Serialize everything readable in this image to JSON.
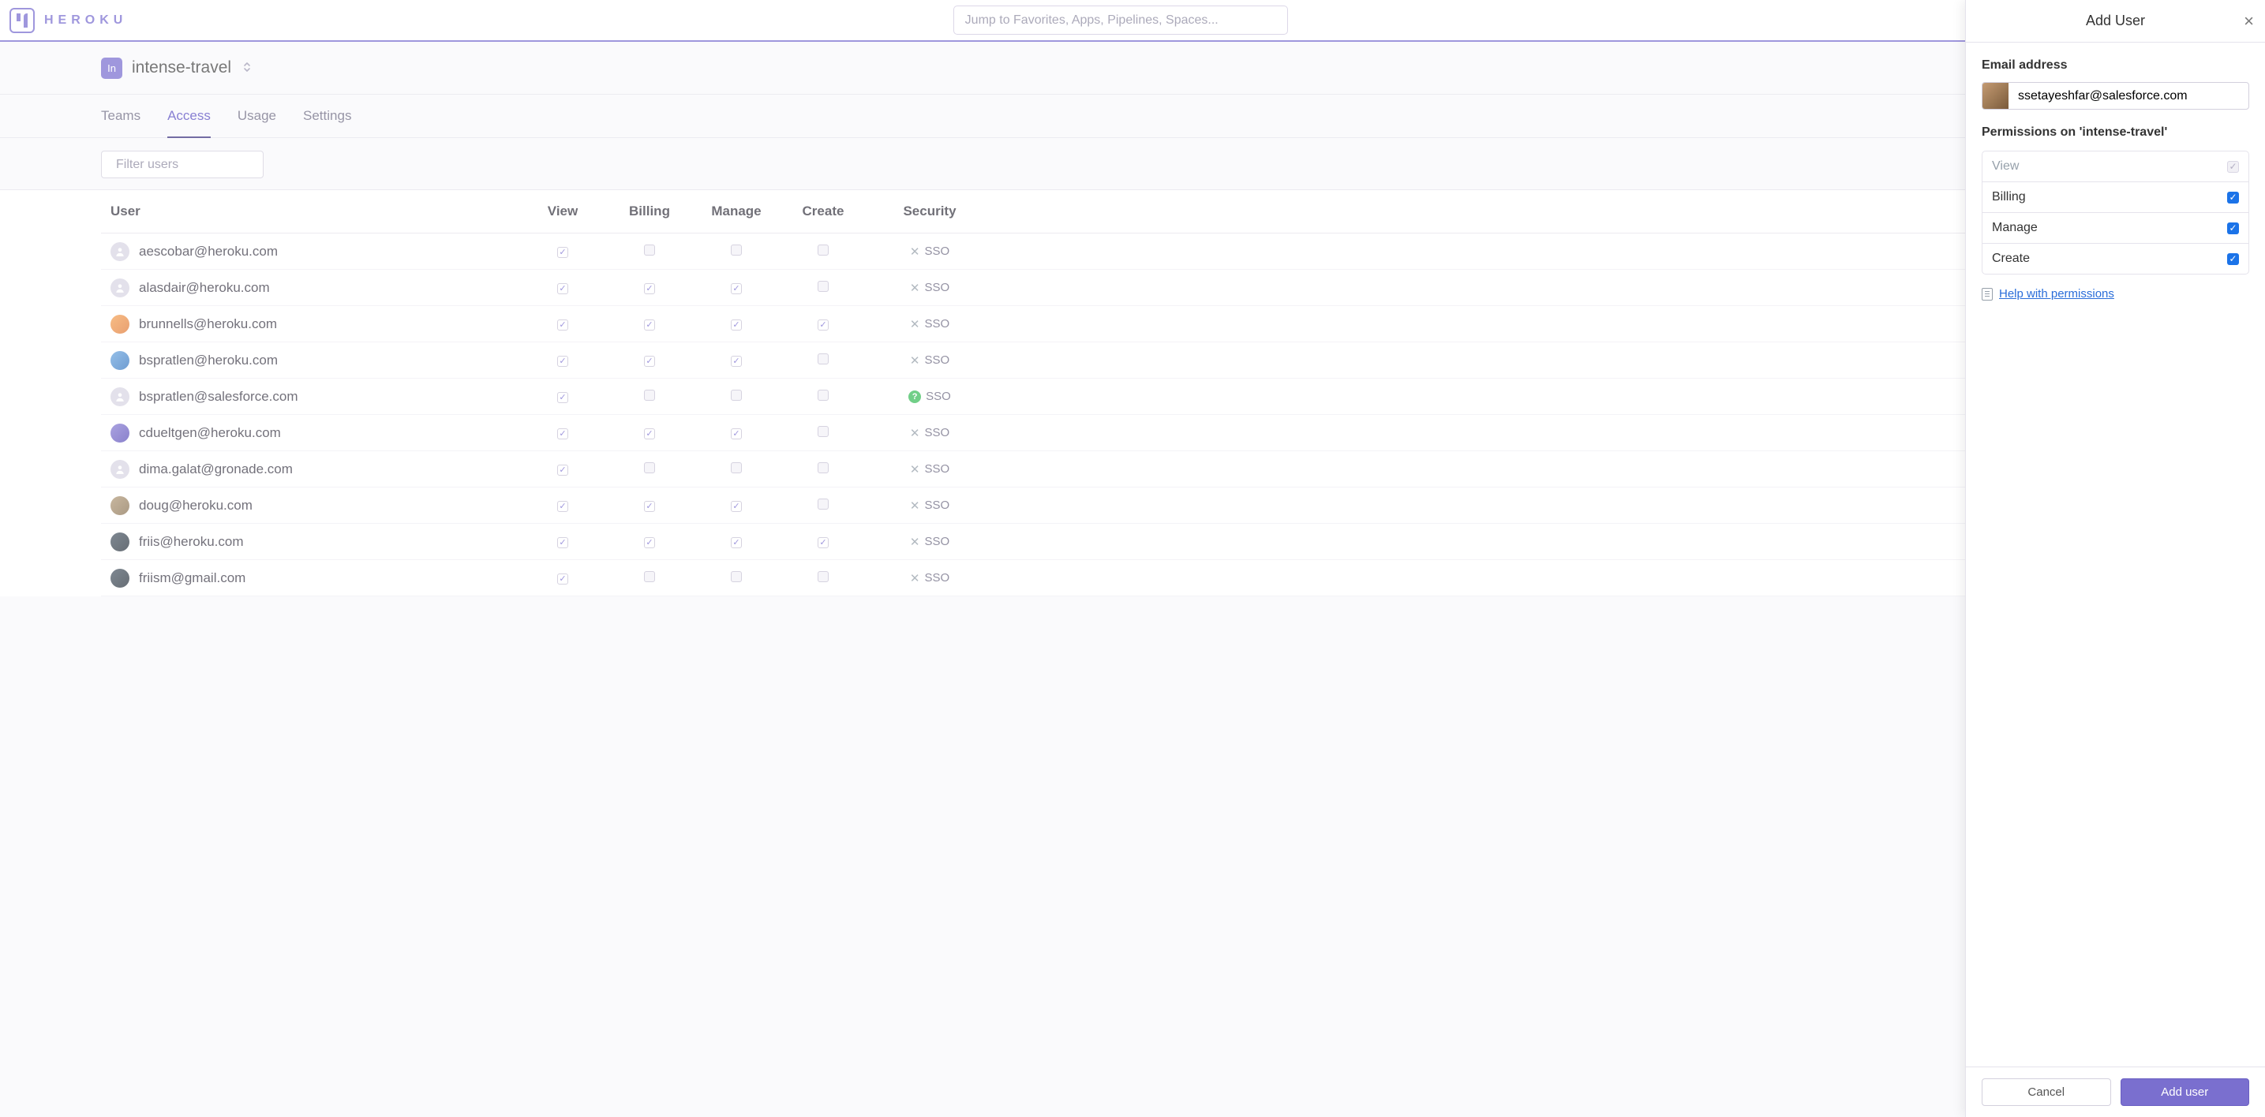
{
  "header": {
    "brand": "HEROKU",
    "search_placeholder": "Jump to Favorites, Apps, Pipelines, Spaces..."
  },
  "context": {
    "chip": "In",
    "team_name": "intense-travel"
  },
  "tabs": {
    "teams": "Teams",
    "access": "Access",
    "usage": "Usage",
    "settings": "Settings",
    "active": "access"
  },
  "filter": {
    "placeholder": "Filter users"
  },
  "table": {
    "columns": {
      "user": "User",
      "view": "View",
      "billing": "Billing",
      "manage": "Manage",
      "create": "Create",
      "security": "Security"
    },
    "sso_label": "SSO",
    "rows": [
      {
        "email": "aescobar@heroku.com",
        "avatar": "",
        "view": true,
        "billing": false,
        "manage": false,
        "create": false,
        "sso": "off"
      },
      {
        "email": "alasdair@heroku.com",
        "avatar": "",
        "view": true,
        "billing": true,
        "manage": true,
        "create": false,
        "sso": "off"
      },
      {
        "email": "brunnells@heroku.com",
        "avatar": "c1",
        "view": true,
        "billing": true,
        "manage": true,
        "create": true,
        "sso": "off"
      },
      {
        "email": "bspratlen@heroku.com",
        "avatar": "c2",
        "view": true,
        "billing": true,
        "manage": true,
        "create": false,
        "sso": "off"
      },
      {
        "email": "bspratlen@salesforce.com",
        "avatar": "",
        "view": true,
        "billing": false,
        "manage": false,
        "create": false,
        "sso": "on"
      },
      {
        "email": "cdueltgen@heroku.com",
        "avatar": "c3",
        "view": true,
        "billing": true,
        "manage": true,
        "create": false,
        "sso": "off"
      },
      {
        "email": "dima.galat@gronade.com",
        "avatar": "",
        "view": true,
        "billing": false,
        "manage": false,
        "create": false,
        "sso": "off"
      },
      {
        "email": "doug@heroku.com",
        "avatar": "c5",
        "view": true,
        "billing": true,
        "manage": true,
        "create": false,
        "sso": "off"
      },
      {
        "email": "friis@heroku.com",
        "avatar": "c4",
        "view": true,
        "billing": true,
        "manage": true,
        "create": true,
        "sso": "off"
      },
      {
        "email": "friism@gmail.com",
        "avatar": "c4",
        "view": true,
        "billing": false,
        "manage": false,
        "create": false,
        "sso": "off"
      }
    ]
  },
  "panel": {
    "title": "Add User",
    "email_label": "Email address",
    "email_value": "ssetayeshfar@salesforce.com",
    "permissions_label": "Permissions on 'intense-travel'",
    "help_text": "Help with permissions",
    "permissions": [
      {
        "name": "View",
        "checked": true,
        "locked": true
      },
      {
        "name": "Billing",
        "checked": true,
        "locked": false
      },
      {
        "name": "Manage",
        "checked": true,
        "locked": false
      },
      {
        "name": "Create",
        "checked": true,
        "locked": false
      }
    ],
    "cancel": "Cancel",
    "submit": "Add user"
  }
}
